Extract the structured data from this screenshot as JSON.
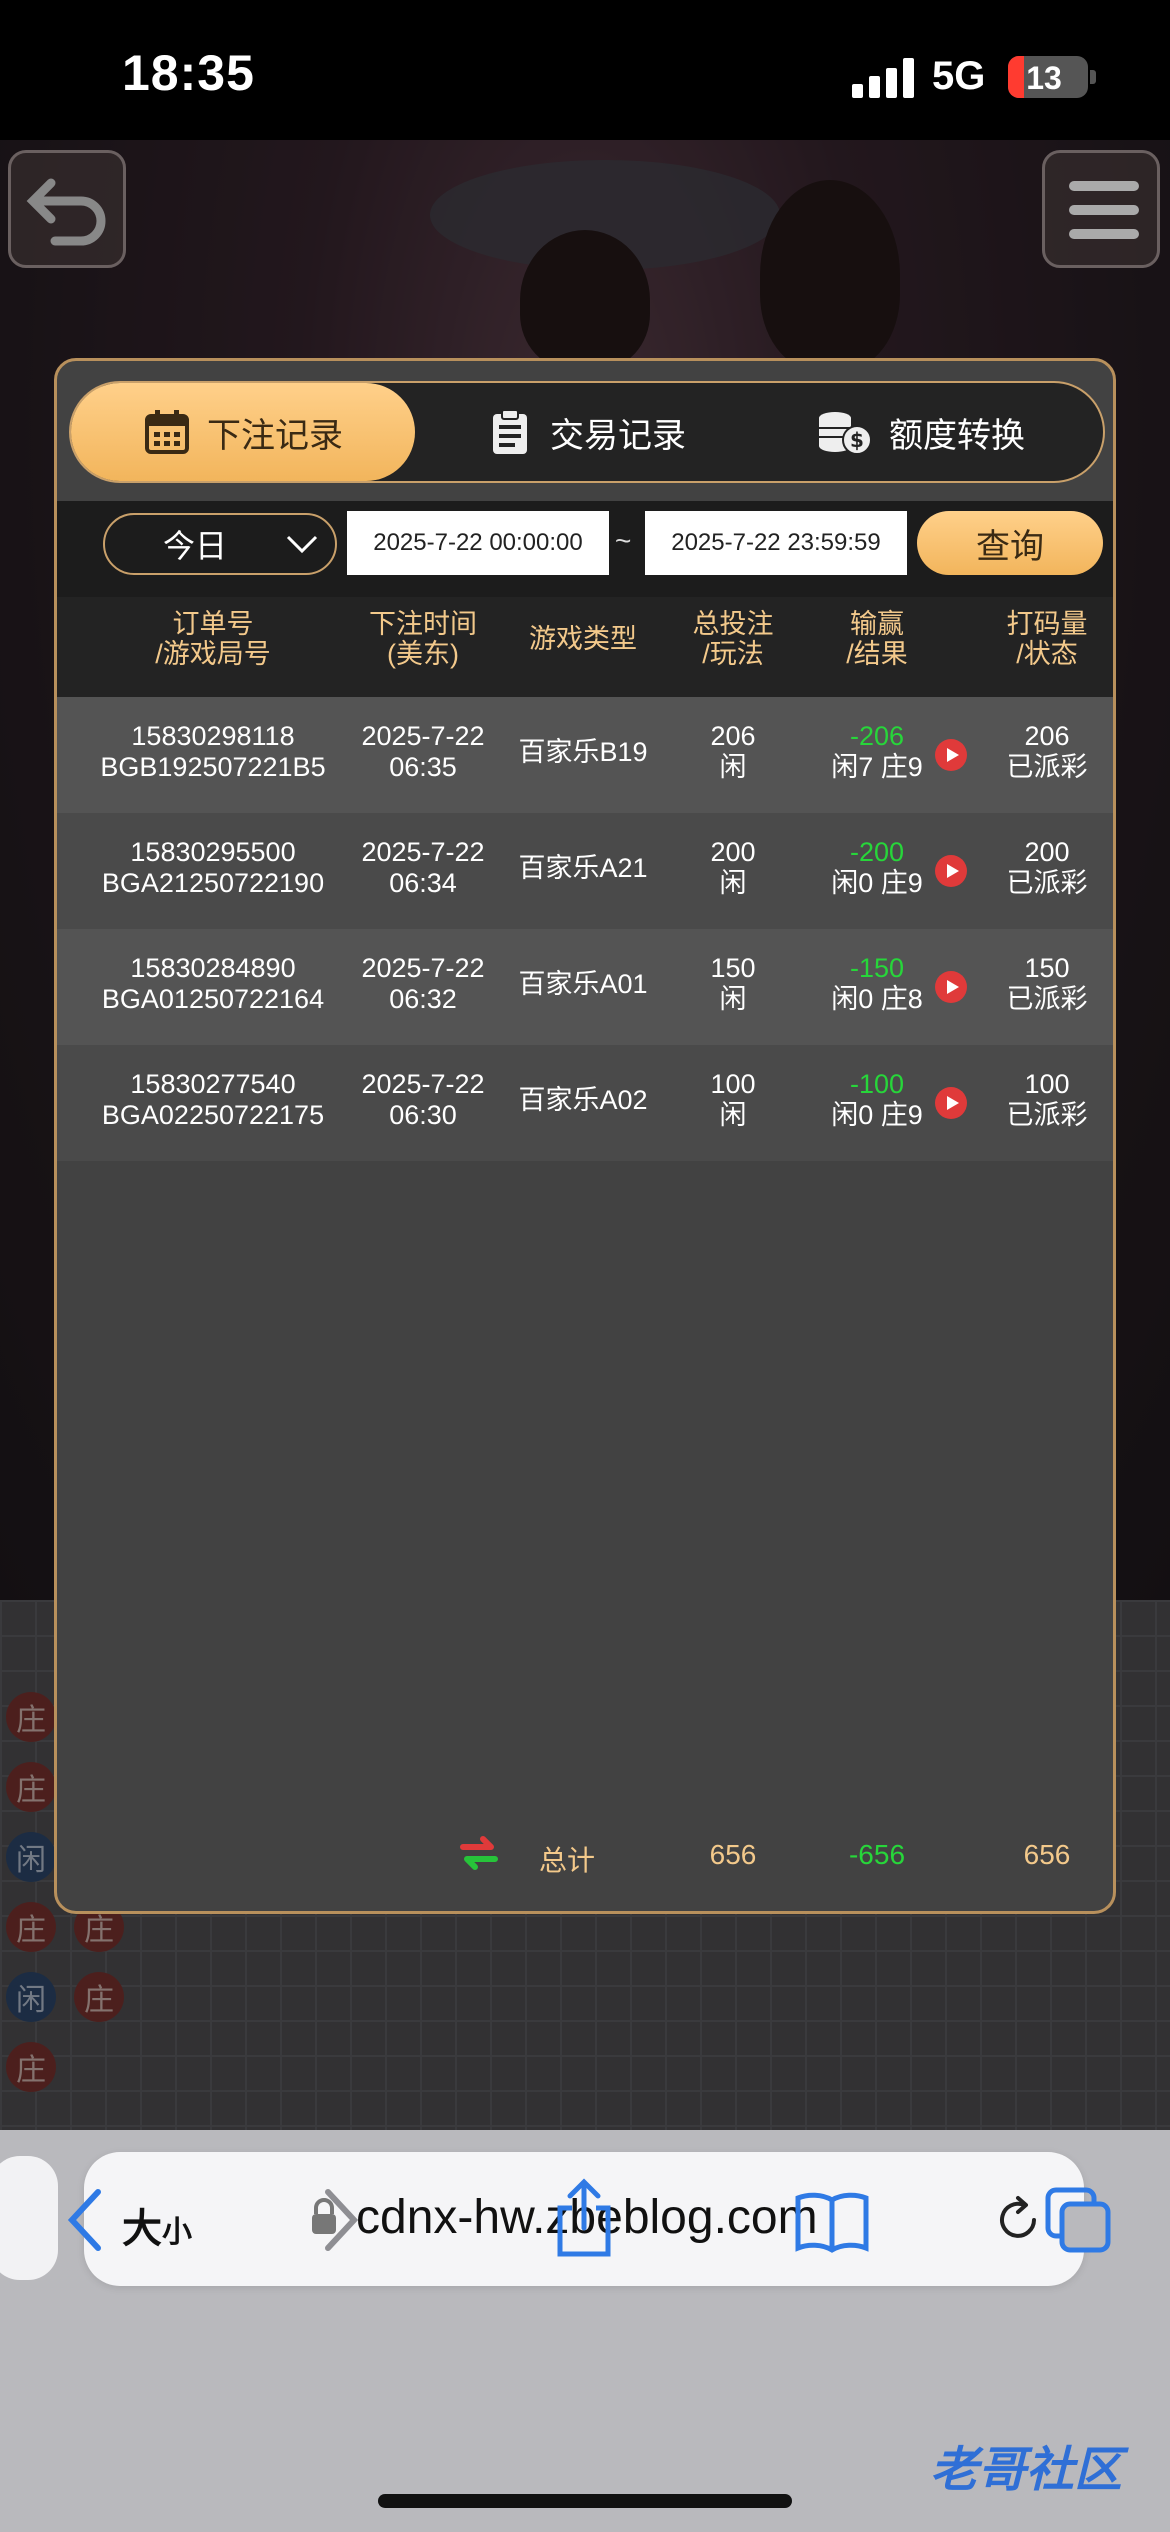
{
  "status_bar": {
    "time": "18:35",
    "network": "5G",
    "battery": "13"
  },
  "tabs": [
    {
      "label": "下注记录",
      "icon": "calendar-icon",
      "active": true
    },
    {
      "label": "交易记录",
      "icon": "clipboard-icon",
      "active": false
    },
    {
      "label": "额度转换",
      "icon": "coins-icon",
      "active": false
    }
  ],
  "filter": {
    "period": "今日",
    "start": "2025-7-22 00:00:00",
    "separator": "~",
    "end": "2025-7-22 23:59:59",
    "query_label": "查询"
  },
  "columns": [
    {
      "l1": "订单号",
      "l2": "/游戏局号"
    },
    {
      "l1": "下注时间",
      "l2": "(美东)"
    },
    {
      "l1": "游戏类型",
      "l2": ""
    },
    {
      "l1": "总投注",
      "l2": "/玩法"
    },
    {
      "l1": "输赢",
      "l2": "/结果"
    },
    {
      "l1": "打码量",
      "l2": "/状态"
    }
  ],
  "rows": [
    {
      "order": "15830298118",
      "round": "BGB192507221B5",
      "date": "2025-7-22",
      "time": "06:35",
      "game": "百家乐B19",
      "bet": "206",
      "play": "闲",
      "win": "-206",
      "result": "闲7 庄9",
      "valid": "206",
      "status": "已派彩"
    },
    {
      "order": "15830295500",
      "round": "BGA21250722190",
      "date": "2025-7-22",
      "time": "06:34",
      "game": "百家乐A21",
      "bet": "200",
      "play": "闲",
      "win": "-200",
      "result": "闲0 庄9",
      "valid": "200",
      "status": "已派彩"
    },
    {
      "order": "15830284890",
      "round": "BGA01250722164",
      "date": "2025-7-22",
      "time": "06:32",
      "game": "百家乐A01",
      "bet": "150",
      "play": "闲",
      "win": "-150",
      "result": "闲0 庄8",
      "valid": "150",
      "status": "已派彩"
    },
    {
      "order": "15830277540",
      "round": "BGA02250722175",
      "date": "2025-7-22",
      "time": "06:30",
      "game": "百家乐A02",
      "bet": "100",
      "play": "闲",
      "win": "-100",
      "result": "闲0 庄9",
      "valid": "100",
      "status": "已派彩"
    }
  ],
  "total": {
    "label": "总计",
    "bet": "656",
    "win": "-656",
    "valid": "656"
  },
  "browser": {
    "size_label": "大",
    "size_small": "小",
    "url": "cdnx-hw.zbeblog.com"
  },
  "watermark": "老哥社区",
  "colors": {
    "accent": "#f2b55c",
    "loss": "#27d63a",
    "border": "#b8905c"
  }
}
